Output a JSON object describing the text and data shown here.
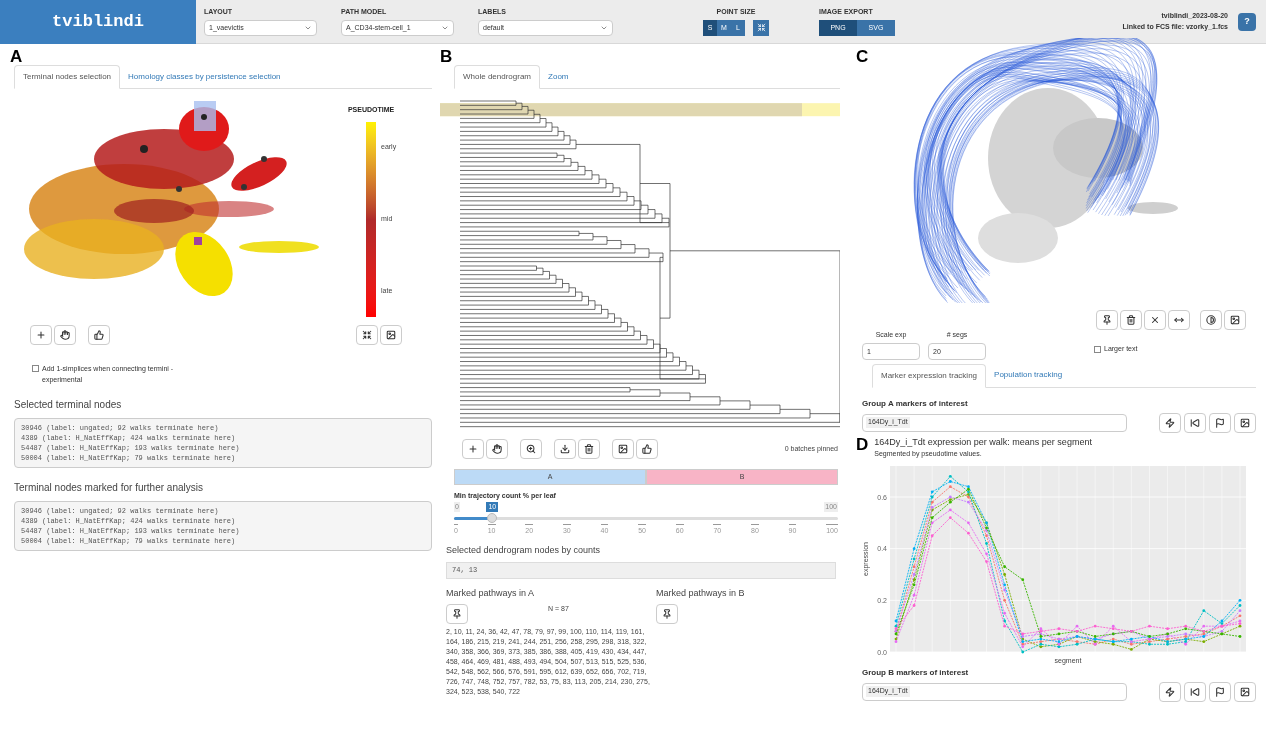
{
  "header": {
    "logo": "tviblindi",
    "selects": [
      {
        "label": "LAYOUT",
        "value": "1_vaevictis"
      },
      {
        "label": "PATH MODEL",
        "value": "A_CD34-stem-cell_1"
      },
      {
        "label": "LABELS",
        "value": "default"
      }
    ],
    "point_size": {
      "label": "POINT SIZE",
      "options": [
        {
          "label": "S",
          "selected": true
        },
        {
          "label": "M",
          "selected": false
        },
        {
          "label": "L",
          "selected": false
        }
      ]
    },
    "image_export": {
      "label": "IMAGE EXPORT",
      "options": [
        {
          "label": "PNG",
          "selected": true
        },
        {
          "label": "SVG",
          "selected": false
        }
      ]
    },
    "version": "tviblindi_2023-08-20",
    "linked_file": "Linked to FCS file: vzorky_1.fcs",
    "help": "?"
  },
  "panel_a": {
    "letter": "A",
    "tabs": [
      {
        "label": "Terminal nodes selection",
        "selected": true
      },
      {
        "label": "Homology classes by persistence selection",
        "selected": false
      }
    ],
    "legend": {
      "title": "PSEUDOTIME",
      "labels": [
        "early",
        "mid",
        "late"
      ]
    },
    "checkbox": {
      "label": "Add 1-simplices when connecting termini - experimental",
      "checked": false
    },
    "sections": [
      {
        "heading": "Selected terminal nodes",
        "lines": [
          "30946 (label: ungated; 92 walks terminate here)",
          "4389 (label: H_NatEffKap; 424 walks terminate here)",
          "54487 (label: H_NatEffKap; 193 walks terminate here)",
          "50004 (label: H_NatEffKap; 79 walks terminate here)"
        ]
      },
      {
        "heading": "Terminal nodes marked for further analysis",
        "lines": [
          "30946 (label: ungated; 92 walks terminate here)",
          "4389 (label: H_NatEffKap; 424 walks terminate here)",
          "54487 (label: H_NatEffKap; 193 walks terminate here)",
          "50004 (label: H_NatEffKap; 79 walks terminate here)"
        ]
      }
    ]
  },
  "panel_b": {
    "letter": "B",
    "tabs": [
      {
        "label": "Whole dendrogram",
        "selected": true
      },
      {
        "label": "Zoom",
        "selected": false
      }
    ],
    "batches": "0 batches pinned",
    "groups": [
      {
        "label": "A",
        "color": "#bcdaf6"
      },
      {
        "label": "B",
        "color": "#f8b4c6"
      }
    ],
    "slider": {
      "label": "Min trajectory count % per leaf",
      "min": "0",
      "max": "100",
      "value": "10",
      "level": 0.1,
      "ticks": [
        "0",
        "10",
        "20",
        "30",
        "40",
        "50",
        "60",
        "70",
        "80",
        "90",
        "100"
      ]
    },
    "nodes": {
      "heading": "Selected dendrogram nodes by counts",
      "value": "74, 13"
    },
    "pathways": [
      {
        "heading": "Marked pathways in A",
        "count": "N = 87",
        "list": "2, 10, 11, 24, 36, 42, 47, 78, 79, 97, 99, 100, 110, 114, 119, 161, 164, 186, 215, 219, 241, 244, 251, 256, 258, 295, 298, 318, 322, 340, 358, 366, 369, 373, 385, 386, 388, 405, 419, 430, 434, 447, 458, 464, 469, 481, 488, 493, 494, 504, 507, 513, 515, 525, 536, 542, 548, 562, 566, 576, 591, 595, 612, 639, 652, 656, 702, 719, 726, 747, 748, 752, 757, 782, 53, 75, 83, 113, 205, 214, 230, 275, 324, 523, 538, 540, 722"
      },
      {
        "heading": "Marked pathways in B"
      }
    ]
  },
  "panel_c": {
    "letter": "C",
    "scale_exp": {
      "label": "Scale exp",
      "value": "1"
    },
    "segs": {
      "label": "# segs",
      "value": "20"
    },
    "larger_text": {
      "label": "Larger text",
      "checked": false
    },
    "tabs": [
      {
        "label": "Marker expression tracking",
        "selected": true
      },
      {
        "label": "Population tracking",
        "selected": false
      }
    ],
    "group_a": {
      "label": "Group A markers of interest",
      "tag": "164Dy_i_Tdt"
    }
  },
  "panel_d": {
    "letter": "D",
    "title": "164Dy_i_Tdt expression per walk: means per segment",
    "subtitle": "Segmented by pseudotime values.",
    "chart_data": {
      "type": "line",
      "xlabel": "segment",
      "ylabel": "expression",
      "ylim": [
        0,
        0.72
      ],
      "yticks": [
        {
          "value": 0,
          "label": "0.0"
        },
        {
          "value": 0.2,
          "label": "0.2"
        },
        {
          "value": 0.4,
          "label": "0.4"
        },
        {
          "value": 0.6,
          "label": "0.6"
        }
      ],
      "grid": true,
      "series": [
        {
          "color": "#f8766d",
          "line_style": "dashed",
          "values": [
            0.08,
            0.33,
            0.58,
            0.64,
            0.6,
            0.45,
            0.2,
            0.03,
            0.04,
            0.05,
            0.04,
            0.03,
            0.05,
            0.03,
            0.04,
            0.05,
            0.06,
            0.07,
            0.1,
            0.14
          ]
        },
        {
          "color": "#7cae00",
          "line_style": "dashed",
          "values": [
            0.05,
            0.28,
            0.55,
            0.59,
            0.61,
            0.5,
            0.3,
            0.05,
            0.02,
            0.03,
            0.06,
            0.04,
            0.03,
            0.01,
            0.05,
            0.04,
            0.05,
            0.04,
            0.07,
            0.1
          ]
        },
        {
          "color": "#00bfc4",
          "line_style": "dashed",
          "values": [
            0.1,
            0.36,
            0.6,
            0.68,
            0.62,
            0.42,
            0.12,
            0.0,
            0.03,
            0.02,
            0.03,
            0.05,
            0.04,
            0.04,
            0.03,
            0.03,
            0.04,
            0.16,
            0.11,
            0.18
          ]
        },
        {
          "color": "#c77cff",
          "line_style": "dashed",
          "values": [
            0.08,
            0.3,
            0.56,
            0.6,
            0.58,
            0.47,
            0.24,
            0.06,
            0.07,
            0.05,
            0.06,
            0.05,
            0.07,
            0.08,
            0.05,
            0.06,
            0.07,
            0.06,
            0.08,
            0.16
          ]
        },
        {
          "color": "#e76bf3",
          "line_style": "dashed",
          "values": [
            0.04,
            0.22,
            0.5,
            0.55,
            0.5,
            0.38,
            0.15,
            0.02,
            0.09,
            0.03,
            0.1,
            0.03,
            0.1,
            0.04,
            0.05,
            0.07,
            0.03,
            0.1,
            0.1,
            0.12
          ]
        },
        {
          "color": "#00b0f6",
          "line_style": "dashed",
          "values": [
            0.12,
            0.4,
            0.62,
            0.66,
            0.64,
            0.5,
            0.26,
            0.04,
            0.05,
            0.04,
            0.06,
            0.05,
            0.04,
            0.05,
            0.06,
            0.04,
            0.05,
            0.06,
            0.12,
            0.2
          ]
        },
        {
          "color": "#39b600",
          "line_style": "dashed",
          "values": [
            0.07,
            0.26,
            0.52,
            0.58,
            0.63,
            0.48,
            0.33,
            0.28,
            0.06,
            0.07,
            0.08,
            0.06,
            0.07,
            0.08,
            0.06,
            0.07,
            0.09,
            0.08,
            0.07,
            0.06
          ]
        },
        {
          "color": "#fd61d1",
          "line_style": "dashed",
          "values": [
            0.09,
            0.18,
            0.45,
            0.52,
            0.46,
            0.35,
            0.1,
            0.07,
            0.08,
            0.09,
            0.08,
            0.1,
            0.09,
            0.08,
            0.1,
            0.09,
            0.1,
            0.08,
            0.1,
            0.11
          ]
        }
      ]
    },
    "group_b": {
      "label": "Group B markers of interest",
      "tag": "164Dy_i_Tdt"
    }
  }
}
